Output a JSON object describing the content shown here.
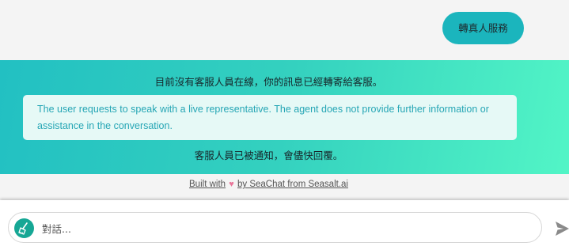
{
  "chat": {
    "handoff_button_label": "轉真人服務"
  },
  "banner": {
    "status_text": "目前沒有客服人員在線，你的訊息已經轉寄給客服。",
    "summary_text": "The user requests to speak with a live representative. The agent does not provide further information or assistance in the conversation.",
    "notify_text": "客服人員已被通知，會儘快回覆。"
  },
  "footer": {
    "built_with": "Built with",
    "by_text": "by SeaChat from Seasalt.ai"
  },
  "composer": {
    "placeholder": "對話..."
  },
  "icons": {
    "heart": "heart-icon",
    "avatar": "broom-avatar-icon",
    "send": "send-icon"
  },
  "colors": {
    "accent": "#1bb5bd",
    "banner_start": "#22c0c2",
    "banner_end": "#52f5c6",
    "summary_text": "#26a6b5",
    "avatar": "#16a795"
  }
}
